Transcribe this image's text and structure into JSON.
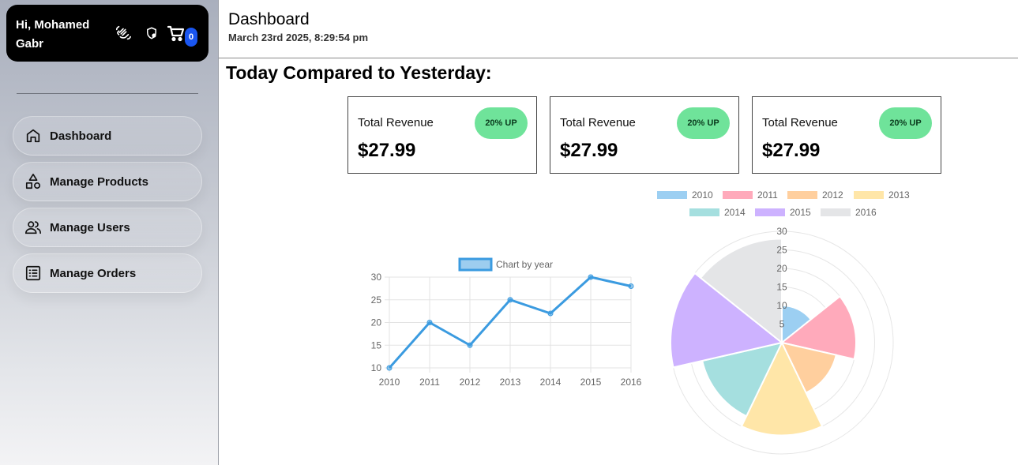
{
  "sidebar": {
    "greeting": "Hi, Mohamed Gabr",
    "cart_count": "0",
    "items": [
      {
        "label": "Dashboard",
        "icon": "home-icon"
      },
      {
        "label": "Manage Products",
        "icon": "shapes-icon"
      },
      {
        "label": "Manage Users",
        "icon": "users-icon"
      },
      {
        "label": "Manage Orders",
        "icon": "list-icon"
      }
    ]
  },
  "header": {
    "title": "Dashboard",
    "datetime": "March 23rd 2025, 8:29:54 pm"
  },
  "main": {
    "section_title": "Today Compared to Yesterday:",
    "cards": [
      {
        "label": "Total Revenue",
        "value": "$27.99",
        "badge": "20% UP"
      },
      {
        "label": "Total Revenue",
        "value": "$27.99",
        "badge": "20% UP"
      },
      {
        "label": "Total Revenue",
        "value": "$27.99",
        "badge": "20% UP"
      }
    ]
  },
  "chart_data": [
    {
      "type": "line",
      "x": [
        "2010",
        "2011",
        "2012",
        "2013",
        "2014",
        "2015",
        "2016"
      ],
      "series": [
        {
          "name": "Chart by year",
          "values": [
            10,
            20,
            15,
            25,
            22,
            30,
            28
          ]
        }
      ],
      "ylim": [
        10,
        30
      ],
      "yticks": [
        10,
        15,
        20,
        25,
        30
      ],
      "color": "#3b9be0",
      "grid": true,
      "legend": "top"
    },
    {
      "type": "polarArea",
      "categories": [
        "2010",
        "2011",
        "2012",
        "2013",
        "2014",
        "2015",
        "2016"
      ],
      "values": [
        10,
        20,
        15,
        25,
        22,
        30,
        28
      ],
      "colors": [
        "#9ccff2",
        "#ffaabb",
        "#ffcf9e",
        "#ffe6a8",
        "#a5dfdf",
        "#cdb2ff",
        "#e4e5e7"
      ],
      "rlim": [
        0,
        30
      ],
      "rticks": [
        5,
        10,
        15,
        20,
        25,
        30
      ],
      "legend": "top"
    }
  ]
}
